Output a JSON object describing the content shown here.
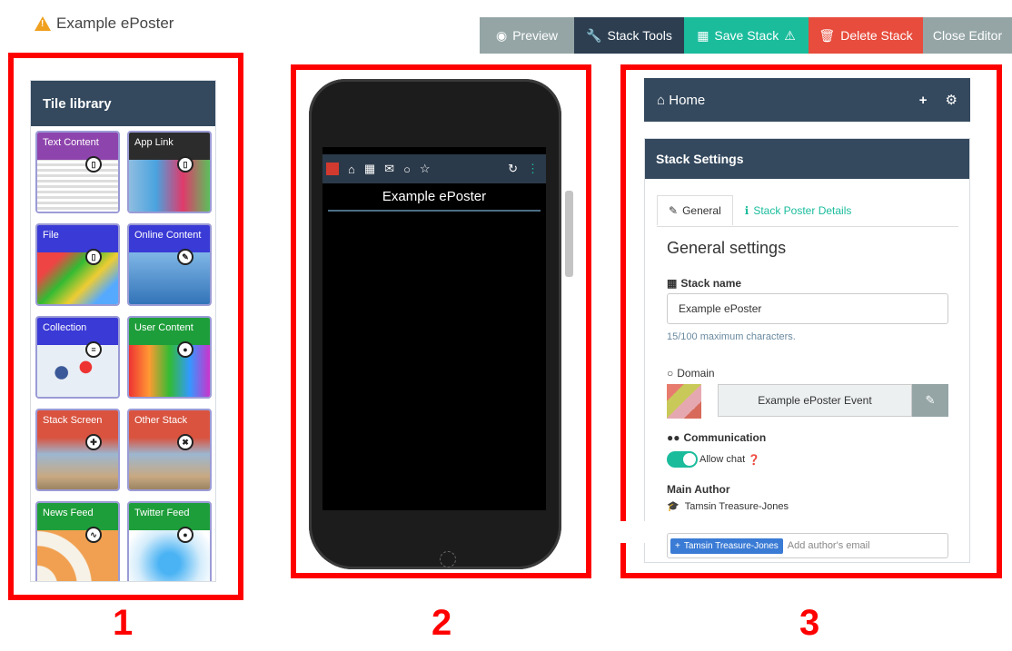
{
  "header": {
    "app_title": "Example ePoster"
  },
  "toolbar": {
    "preview": "Preview",
    "stack_tools": "Stack Tools",
    "save_stack": "Save Stack",
    "delete_stack": "Delete Stack",
    "close_editor": "Close Editor"
  },
  "callouts": [
    "1",
    "2",
    "3"
  ],
  "tile_library": {
    "title": "Tile library",
    "tiles": [
      {
        "label": "Text Content",
        "color": "#8e44ad"
      },
      {
        "label": "App Link",
        "color": "#2c2c2c"
      },
      {
        "label": "File",
        "color": "#3a3ad6"
      },
      {
        "label": "Online Content",
        "color": "#3a3ad6"
      },
      {
        "label": "Collection",
        "color": "#3a3ad6"
      },
      {
        "label": "User Content",
        "color": "#1e9e3a"
      },
      {
        "label": "Stack Screen",
        "color": "#d9533f"
      },
      {
        "label": "Other Stack",
        "color": "#d9533f"
      },
      {
        "label": "News Feed",
        "color": "#1e9e3a"
      },
      {
        "label": "Twitter Feed",
        "color": "#1e9e3a"
      }
    ]
  },
  "phone": {
    "title": "Example ePoster"
  },
  "editor": {
    "home_label": "Home",
    "stack_settings": "Stack Settings",
    "tab_general": "General",
    "tab_details": "Stack Poster Details",
    "general_settings": "General settings",
    "stack_name_label": "Stack name",
    "stack_name_value": "Example ePoster",
    "stack_name_help": "15/100 maximum characters.",
    "domain_label": "Domain",
    "domain_value": "Example ePoster Event",
    "communication_label": "Communication",
    "allow_chat": "Allow chat",
    "main_author_label": "Main Author",
    "main_author_name": "Tamsin Treasure-Jones",
    "author_chip": "Tamsin Treasure-Jones",
    "author_placeholder": "Add author's email"
  },
  "colors": {
    "dark_header": "#34495e",
    "accent_green": "#1abc9c",
    "danger": "#e74c3c",
    "muted": "#95a5a6",
    "callout_red": "#ff0000"
  }
}
